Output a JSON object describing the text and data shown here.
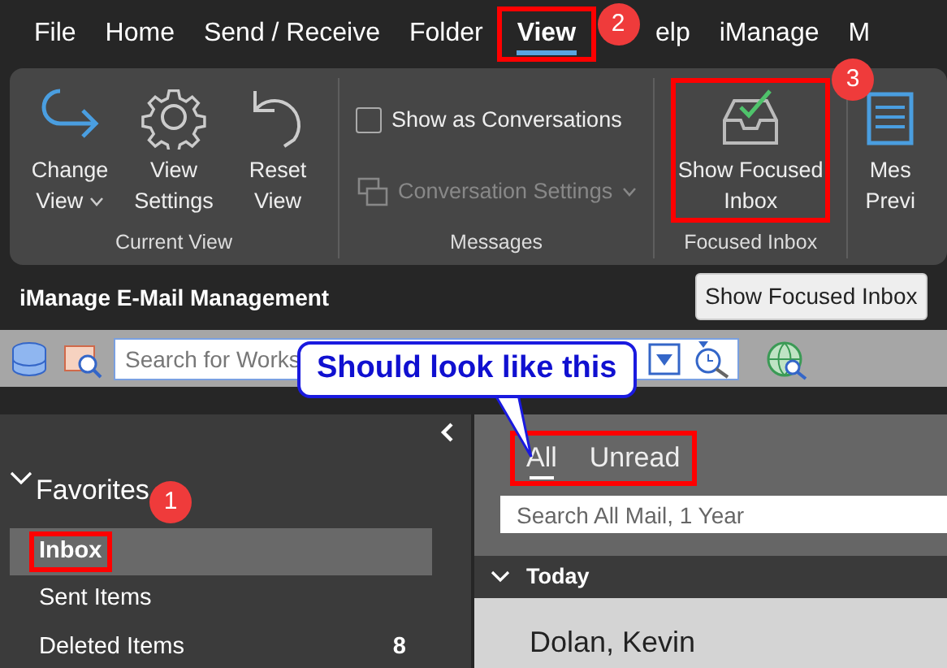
{
  "menu_tabs": [
    {
      "label": "File",
      "selected": false,
      "highlighted": false
    },
    {
      "label": "Home",
      "selected": false,
      "highlighted": false
    },
    {
      "label": "Send / Receive",
      "selected": false,
      "highlighted": false
    },
    {
      "label": "Folder",
      "selected": false,
      "highlighted": false
    },
    {
      "label": "View",
      "selected": true,
      "highlighted": true
    },
    {
      "label": "elp",
      "selected": false,
      "highlighted": false
    },
    {
      "label": "iManage",
      "selected": false,
      "highlighted": false
    },
    {
      "label": "M",
      "selected": false,
      "highlighted": false
    }
  ],
  "ribbon_groups": [
    {
      "label": "Current View",
      "items": [
        {
          "kind": "large",
          "label": "Change View",
          "has_menu": true,
          "highlighted": false
        },
        {
          "kind": "large",
          "label": "View Settings",
          "has_menu": false,
          "highlighted": false
        },
        {
          "kind": "large",
          "label": "Reset View",
          "has_menu": false,
          "highlighted": false
        }
      ]
    },
    {
      "label": "Messages",
      "items": [
        {
          "kind": "checkbox",
          "label": "Show as Conversations",
          "checked": false
        },
        {
          "kind": "small",
          "label": "Conversation Settings",
          "has_menu": true,
          "disabled": true
        }
      ]
    },
    {
      "label": "Focused Inbox",
      "items": [
        {
          "kind": "large",
          "label": "Show Focused Inbox",
          "has_menu": false,
          "highlighted": true
        }
      ]
    },
    {
      "items": [
        {
          "kind": "large",
          "label": "Mes Previ",
          "has_menu": false,
          "highlighted": false
        }
      ]
    }
  ],
  "tooltip": "Show Focused Inbox",
  "addin_title": "iManage E-Mail Management",
  "addin_search": {
    "placeholder": "Search for Works"
  },
  "folders": {
    "header": "Favorites",
    "expanded": true,
    "items": [
      {
        "label": "Inbox",
        "selected": true,
        "highlighted": true
      },
      {
        "label": "Sent Items",
        "selected": false,
        "highlighted": false
      },
      {
        "label": "Deleted Items",
        "selected": false,
        "highlighted": false,
        "count": "8"
      }
    ]
  },
  "mail_filter": {
    "highlighted": true,
    "tabs": [
      {
        "label": "All",
        "selected": true
      },
      {
        "label": "Unread",
        "selected": false
      }
    ]
  },
  "mail_search": {
    "placeholder": "Search All Mail, 1 Year"
  },
  "mail_groups": [
    {
      "label": "Today",
      "expanded": true,
      "messages": [
        {
          "sender": "Dolan, Kevin"
        }
      ]
    }
  ],
  "annotations": {
    "callout": "Should look like this",
    "badges": [
      "1",
      "2",
      "3"
    ]
  }
}
